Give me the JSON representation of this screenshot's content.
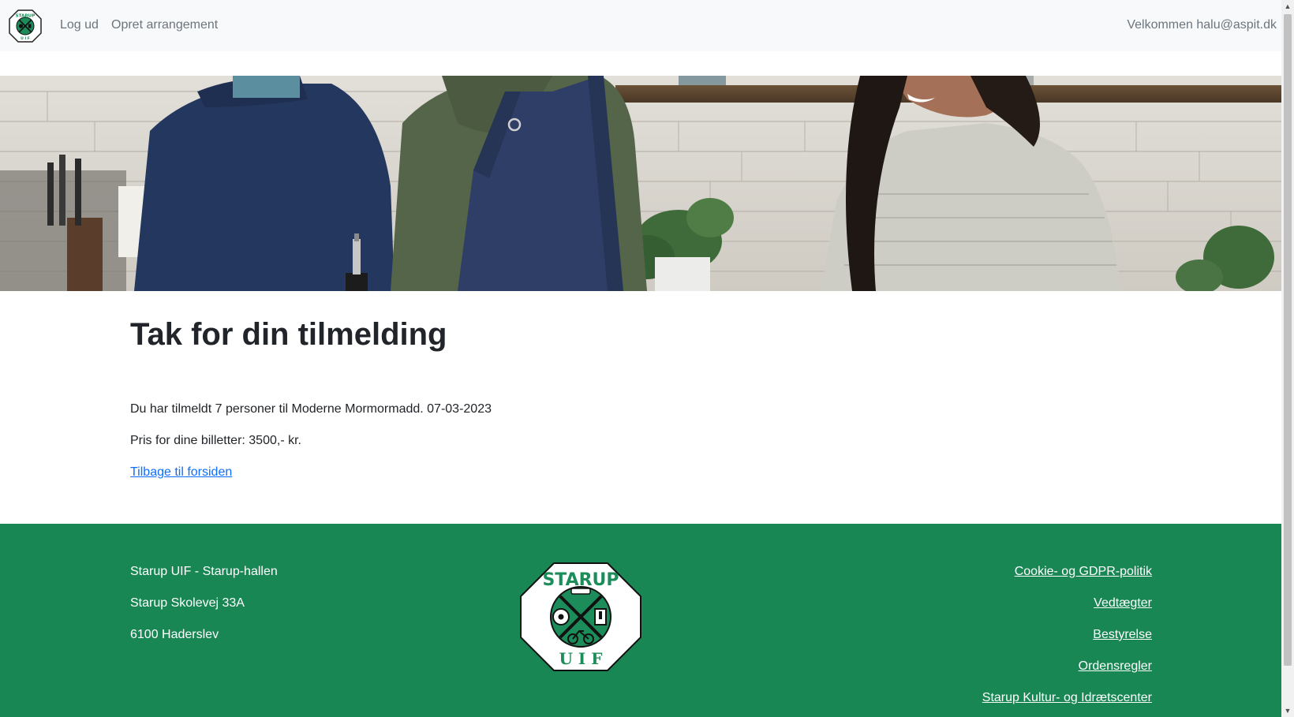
{
  "nav": {
    "logout_label": "Log ud",
    "create_event_label": "Opret arrangement",
    "welcome_text": "Velkommen halu@aspit.dk",
    "logo_text": "STARUP"
  },
  "main": {
    "title": "Tak for din tilmelding",
    "registration_text": "Du har tilmeldt 7 personer til Moderne Mormormadd. 07-03-2023",
    "price_text": "Pris for dine billetter: 3500,- kr.",
    "back_link_label": "Tilbage til forsiden"
  },
  "footer": {
    "address": {
      "name": "Starup UIF - Starup-hallen",
      "street": "Starup Skolevej 33A",
      "city": "6100 Haderslev"
    },
    "logo": {
      "top_text": "STARUP",
      "bottom_text": "U I F"
    },
    "links": [
      {
        "label": "Cookie- og GDPR-politik"
      },
      {
        "label": "Vedtægter"
      },
      {
        "label": "Bestyrelse"
      },
      {
        "label": "Ordensregler"
      },
      {
        "label": "Starup Kultur- og Idrætscenter"
      }
    ]
  },
  "colors": {
    "footer_bg": "#198754",
    "nav_bg": "#f8f9fa",
    "link": "#0d6efd",
    "logo_green": "#1c8c5a"
  }
}
